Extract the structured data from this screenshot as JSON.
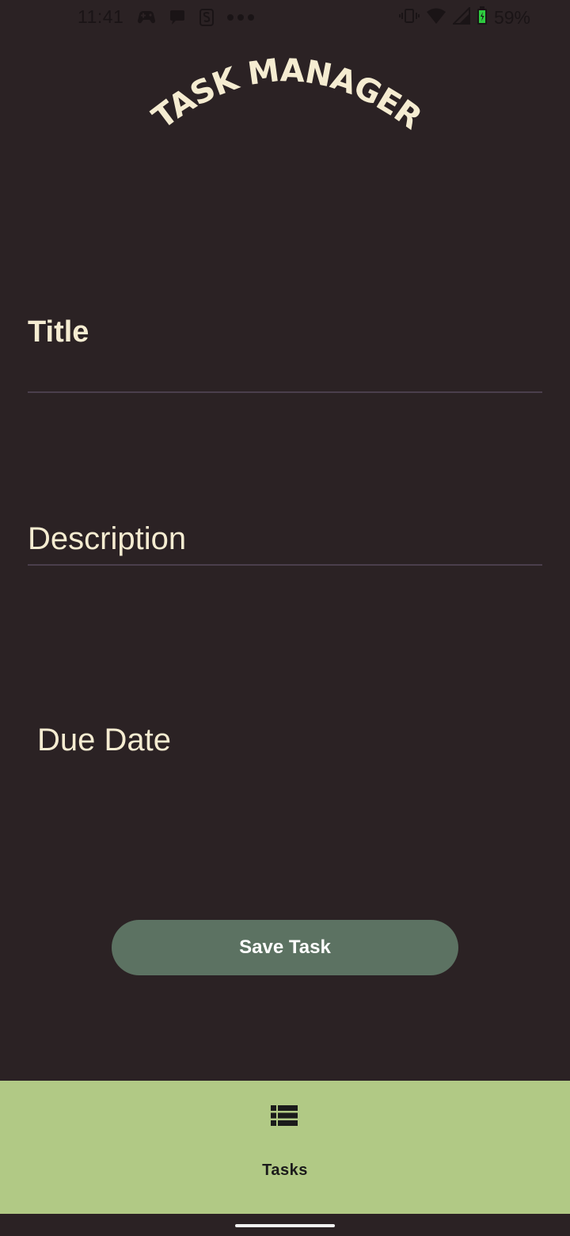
{
  "status_bar": {
    "time": "11:41",
    "battery": "59%",
    "icons": [
      "game-controller-icon",
      "chat-bubble-icon",
      "s-app-icon",
      "more-dots-icon",
      "vibrate-icon",
      "wifi-icon",
      "cell-signal-icon",
      "battery-icon"
    ]
  },
  "header": {
    "title": "TASK MANAGER"
  },
  "form": {
    "title_label": "Title",
    "description_label": "Description",
    "due_date_label": "Due Date",
    "save_label": "Save Task"
  },
  "bottom_nav": {
    "items": [
      {
        "label": "Tasks",
        "icon": "list-icon"
      }
    ]
  },
  "colors": {
    "background": "#2b2224",
    "text_cream": "#f5ecd1",
    "button": "#5c7262",
    "nav_bar": "#b1c985",
    "divider": "#4b3f4c"
  }
}
